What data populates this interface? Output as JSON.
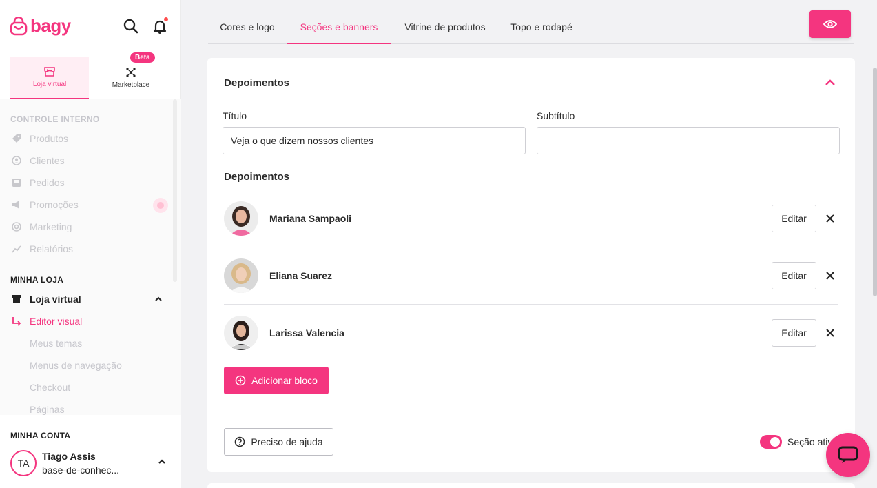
{
  "brand": {
    "name": "bagy",
    "accent": "#f4357f"
  },
  "sidebar": {
    "store_tabs": [
      {
        "label": "Loja virtual",
        "icon": "storefront-icon",
        "active": true
      },
      {
        "label": "Marketplace",
        "icon": "network-icon",
        "badge": "Beta"
      }
    ],
    "internal_section": "CONTROLE INTERNO",
    "internal_items": [
      {
        "label": "Produtos",
        "icon": "tag-icon"
      },
      {
        "label": "Clientes",
        "icon": "user-circle-icon"
      },
      {
        "label": "Pedidos",
        "icon": "inbox-icon"
      },
      {
        "label": "Promoções",
        "icon": "megaphone-icon"
      },
      {
        "label": "Marketing",
        "icon": "target-icon"
      },
      {
        "label": "Relatórios",
        "icon": "trend-icon"
      }
    ],
    "store_section": "MINHA LOJA",
    "store_item": "Loja virtual",
    "editor_item": "Editor visual",
    "sub_items": [
      "Meus temas",
      "Menus de navegação",
      "Checkout",
      "Páginas"
    ],
    "account_section": "MINHA CONTA",
    "user": {
      "initials": "TA",
      "name": "Tiago Assis",
      "store": "base-de-conhec..."
    }
  },
  "tabs": [
    {
      "label": "Cores e logo"
    },
    {
      "label": "Seções e banners",
      "active": true
    },
    {
      "label": "Vitrine de produtos"
    },
    {
      "label": "Topo e rodapé"
    }
  ],
  "section": {
    "title": "Depoimentos",
    "title_label": "Título",
    "title_value": "Veja o que dizem nossos clientes",
    "subtitle_label": "Subtítulo",
    "subtitle_value": "",
    "list_title": "Depoimentos",
    "testimonials": [
      {
        "name": "Mariana Sampaoli",
        "edit_label": "Editar"
      },
      {
        "name": "Eliana Suarez",
        "edit_label": "Editar"
      },
      {
        "name": "Larissa Valencia",
        "edit_label": "Editar"
      }
    ],
    "add_label": "Adicionar bloco",
    "help_label": "Preciso de ajuda",
    "active_label": "Seção ativa"
  }
}
